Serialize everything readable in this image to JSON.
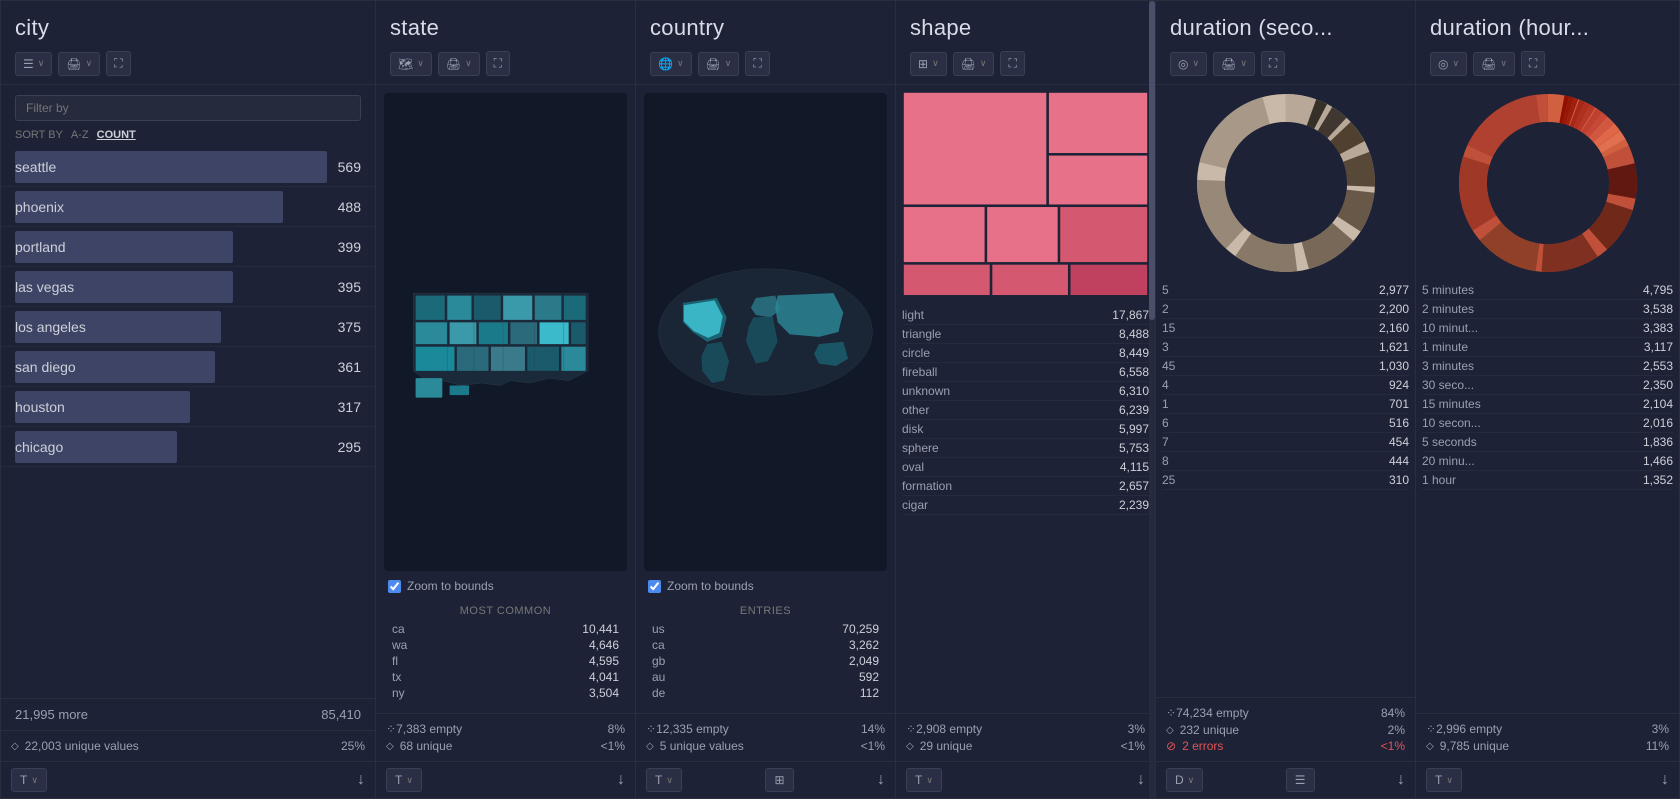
{
  "panels": {
    "city": {
      "title": "city",
      "filter_placeholder": "Filter by",
      "sort_label": "SORT BY",
      "sort_az": "A-Z",
      "sort_count": "COUNT",
      "cities": [
        {
          "name": "seattle",
          "count": "569",
          "bar_pct": 100
        },
        {
          "name": "phoenix",
          "count": "488",
          "bar_pct": 86
        },
        {
          "name": "portland",
          "count": "399",
          "bar_pct": 70
        },
        {
          "name": "las vegas",
          "count": "395",
          "bar_pct": 70
        },
        {
          "name": "los angeles",
          "count": "375",
          "bar_pct": 66
        },
        {
          "name": "san diego",
          "count": "361",
          "bar_pct": 64
        },
        {
          "name": "houston",
          "count": "317",
          "bar_pct": 56
        },
        {
          "name": "chicago",
          "count": "295",
          "bar_pct": 52
        }
      ],
      "more_label": "21,995 more",
      "more_count": "85,410",
      "unique_label": "22,003 unique values",
      "unique_pct": "25%"
    },
    "state": {
      "title": "state",
      "zoom_label": "Zoom to bounds",
      "most_common_header": "MOST COMMON",
      "rows": [
        {
          "label": "ca",
          "value": "10,441"
        },
        {
          "label": "wa",
          "value": "4,646"
        },
        {
          "label": "fl",
          "value": "4,595"
        },
        {
          "label": "tx",
          "value": "4,041"
        },
        {
          "label": "ny",
          "value": "3,504"
        }
      ],
      "empty_label": "7,383 empty",
      "empty_pct": "8%",
      "unique_label": "68 unique",
      "unique_pct": "<1%"
    },
    "country": {
      "title": "country",
      "zoom_label": "Zoom to bounds",
      "entries_header": "ENTRIES",
      "rows": [
        {
          "label": "us",
          "value": "70,259"
        },
        {
          "label": "ca",
          "value": "3,262"
        },
        {
          "label": "gb",
          "value": "2,049"
        },
        {
          "label": "au",
          "value": "592"
        },
        {
          "label": "de",
          "value": "112"
        }
      ],
      "empty_label": "12,335 empty",
      "empty_pct": "14%",
      "unique_label": "5 unique values",
      "unique_pct": "<1%"
    },
    "shape": {
      "title": "shape",
      "rows": [
        {
          "name": "light",
          "count": "17,867"
        },
        {
          "name": "triangle",
          "count": "8,488"
        },
        {
          "name": "circle",
          "count": "8,449"
        },
        {
          "name": "fireball",
          "count": "6,558"
        },
        {
          "name": "unknown",
          "count": "6,310"
        },
        {
          "name": "other",
          "count": "6,239"
        },
        {
          "name": "disk",
          "count": "5,997"
        },
        {
          "name": "sphere",
          "count": "5,753"
        },
        {
          "name": "oval",
          "count": "4,115"
        },
        {
          "name": "formation",
          "count": "2,657"
        },
        {
          "name": "cigar",
          "count": "2,239"
        }
      ],
      "empty_label": "2,908 empty",
      "empty_pct": "3%",
      "unique_label": "29 unique",
      "unique_pct": "<1%"
    },
    "duration_sec": {
      "title": "duration (seco...",
      "rows": [
        {
          "label": "5",
          "value": "2,977"
        },
        {
          "label": "2",
          "value": "2,200"
        },
        {
          "label": "15",
          "value": "2,160"
        },
        {
          "label": "3",
          "value": "1,621"
        },
        {
          "label": "45",
          "value": "1,030"
        },
        {
          "label": "4",
          "value": "924"
        },
        {
          "label": "1",
          "value": "701"
        },
        {
          "label": "6",
          "value": "516"
        },
        {
          "label": "7",
          "value": "454"
        },
        {
          "label": "8",
          "value": "444"
        },
        {
          "label": "25",
          "value": "310"
        }
      ],
      "empty_label": "74,234 empty",
      "empty_pct": "84%",
      "unique_label": "232 unique",
      "unique_pct": "2%",
      "error_label": "2 errors",
      "error_pct": "<1%"
    },
    "duration_hour": {
      "title": "duration (hour...",
      "rows": [
        {
          "label": "5 minutes",
          "value": "4,795"
        },
        {
          "label": "2 minutes",
          "value": "3,538"
        },
        {
          "label": "10 minut...",
          "value": "3,383"
        },
        {
          "label": "1 minute",
          "value": "3,117"
        },
        {
          "label": "3 minutes",
          "value": "2,553"
        },
        {
          "label": "30 seco...",
          "value": "2,350"
        },
        {
          "label": "15 minutes",
          "value": "2,104"
        },
        {
          "label": "10 secon...",
          "value": "2,016"
        },
        {
          "label": "5 seconds",
          "value": "1,836"
        },
        {
          "label": "20 minu...",
          "value": "1,466"
        },
        {
          "label": "1 hour",
          "value": "1,352"
        }
      ],
      "empty_label": "2,996 empty",
      "empty_pct": "3%",
      "unique_label": "9,785 unique",
      "unique_pct": "11%"
    }
  },
  "icons": {
    "filter": "☰",
    "print": "🖨",
    "expand": "⛶",
    "map": "🗺",
    "grid": "⊞",
    "donut": "◎",
    "diamond": "◇",
    "empty_dots": "⁘",
    "circle_minus": "⊘",
    "down_arrow": "↓",
    "chevron_down": "∨"
  },
  "colors": {
    "bar_bg": "#3d4466",
    "pink_light": "#e8718a",
    "pink_medium": "#d45870",
    "pink_dark": "#c04060",
    "donut_sec": [
      "#c9b9a8",
      "#b8a898",
      "#a89888",
      "#988878",
      "#887868",
      "#786858",
      "#685848",
      "#584838",
      "#484828"
    ],
    "donut_hour": [
      "#c0503a",
      "#d06040",
      "#b04030",
      "#e07050",
      "#a03020",
      "#904020",
      "#803010",
      "#702010",
      "#602000",
      "#d08060",
      "#e09070"
    ]
  }
}
